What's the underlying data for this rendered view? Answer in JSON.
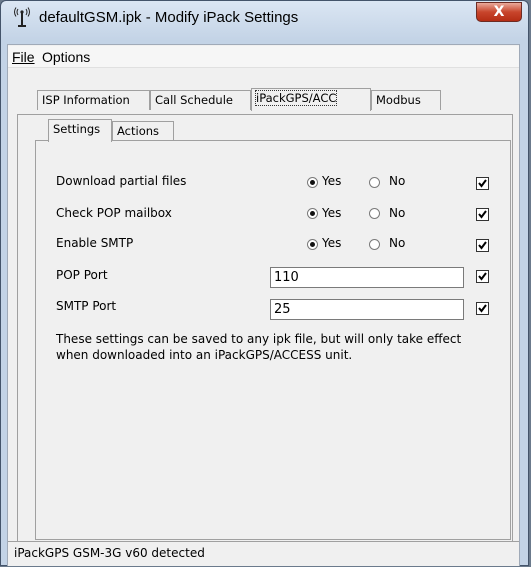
{
  "window": {
    "title": "defaultGSM.ipk - Modify iPack Settings",
    "close_label": "X"
  },
  "menu": {
    "items": [
      {
        "label": "File",
        "accel": "F"
      },
      {
        "label": "Options",
        "accel": "O"
      }
    ]
  },
  "tabs": [
    {
      "label": "ISP Information"
    },
    {
      "label": "Call Schedule"
    },
    {
      "label": "iPackGPS/ACC",
      "active": true
    },
    {
      "label": "Modbus"
    }
  ],
  "subtabs": [
    {
      "label": "Settings",
      "active": true
    },
    {
      "label": "Actions"
    }
  ],
  "settings": {
    "rows": [
      {
        "label": "Download partial files",
        "yes_label": "Yes",
        "no_label": "No",
        "selected": "Yes",
        "checked": true
      },
      {
        "label": "Check POP mailbox",
        "yes_label": "Yes",
        "no_label": "No",
        "selected": "Yes",
        "checked": true
      },
      {
        "label": "Enable SMTP",
        "yes_label": "Yes",
        "no_label": "No",
        "selected": "Yes",
        "checked": true
      }
    ],
    "pop_port": {
      "label": "POP Port",
      "value": "110",
      "checked": true
    },
    "smtp_port": {
      "label": "SMTP Port",
      "value": "25",
      "checked": true
    },
    "note": "These settings can be saved to any ipk file, but will only take effect when downloaded into an iPackGPS/ACCESS unit."
  },
  "status": {
    "text": "iPackGPS GSM-3G v60 detected"
  }
}
